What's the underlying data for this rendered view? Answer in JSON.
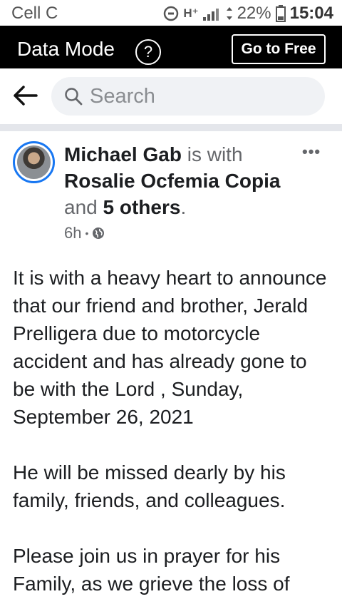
{
  "status_bar": {
    "carrier": "Cell C",
    "network": "H⁺",
    "battery": "22%",
    "time": "15:04"
  },
  "data_mode": {
    "title": "Data Mode",
    "help_label": "?",
    "go_free_label": "Go to Free"
  },
  "search": {
    "placeholder": "Search"
  },
  "post": {
    "author": "Michael Gab",
    "is_with": "is with",
    "tagged": "Rosalie Ocfemia Copia",
    "and": "and",
    "others": "5 others",
    "period": ".",
    "time": "6h",
    "dot": "•",
    "more": "•••",
    "paragraphs": [
      "It is with a heavy heart to announce that our friend and brother, Jerald Prelligera due to motorcycle accident and has already gone to be with the Lord , Sunday, September 26, 2021",
      "He will be missed dearly by his family, friends, and colleagues.",
      "Please join us in prayer for his Family, as we grieve the loss of"
    ]
  },
  "colors": {
    "accent": "#1877f2",
    "bar_bg": "#000000",
    "search_bg": "#f0f2f5",
    "divider": "#e4e6eb"
  }
}
